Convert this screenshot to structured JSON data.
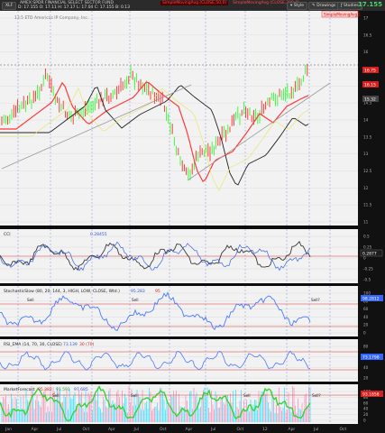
{
  "toolbar": {
    "symbol": "XLF",
    "description": "AMEX:SPDR FINANCIAL SELECT SECTOR FUND",
    "ohlc": "D: 17.155  O: 17.11  H: 17.17  L: 17.04  C: 17.155  B: 0.13",
    "study_a": "SimpleMovingAvg (CLOSE,50,0)",
    "study_b": "SimpleMovingAvg (CLOSE,200,0)",
    "style_btn": "Style",
    "drawings_btn": "Drawings",
    "studies_btn": "Studies",
    "last_price": "17.155"
  },
  "main_pane": {
    "subtitle": "13.5 ETD Americas IP Company, Inc.",
    "legend_tag": "SimpleMovingAvg 1",
    "price_labels": [
      "16.75",
      "16.15",
      "15.32"
    ],
    "axis_ticks": [
      "17",
      "16.5",
      "16",
      "15.5",
      "15",
      "14.5",
      "14",
      "13.5",
      "13",
      "12.5",
      "12",
      "11.5",
      "11"
    ]
  },
  "pane2": {
    "label": "CCI",
    "value_tag": "0.28455",
    "value": "0.2877",
    "axis_ticks": [
      "0.5",
      "0.25",
      "0",
      "-0.25",
      "-0.5"
    ]
  },
  "pane3": {
    "label": "StochasticSlow (80, 20, 144, 3, HIGH, LOW, CLOSE, Wtd.)",
    "value_tag_a": "95.283",
    "value_tag_b": "95",
    "sell_markers": [
      "Sell",
      "Sell",
      "Sell?"
    ],
    "value": "98.2812",
    "axis_ticks": [
      "100",
      "80",
      "60",
      "40",
      "20",
      "0"
    ]
  },
  "pane4": {
    "label": "RSI_EMA (14, 70, 30, CLOSE)",
    "value_tag_a": "73.139",
    "value_tag_b": "30 (70)",
    "value": "73.1798",
    "axis_ticks": [
      "80",
      "60",
      "40",
      "20"
    ]
  },
  "pane5": {
    "label": "MarketForecast",
    "value_tags": [
      "95.382",
      "91.591",
      "97.685"
    ],
    "sell_markers": [
      "Sell",
      "Sell",
      "Sell",
      "Sell?"
    ],
    "value": "93.1858",
    "axis_ticks": [
      "100",
      "80",
      "60",
      "40",
      "20",
      "0"
    ]
  },
  "time_axis": [
    "Jan",
    "Apr",
    "Jul",
    "Oct",
    "Apr",
    "Jul",
    "Oct",
    "Apr",
    "Jul",
    "Oct",
    "12",
    "Apr",
    "Jul",
    "Oct"
  ],
  "colors": {
    "price_up": "#2cff2c",
    "price_down": "#ff2a2a",
    "sma50": "#ff3a3a",
    "sma200": "#c8c8c8",
    "trendline": "#9a9a9a",
    "osc_blue": "#4a7bff",
    "mf_green": "#37d437",
    "mf_red": "#ff4a4a",
    "mf_cyan": "#5ee6ff",
    "label_red_bg": "#d62020",
    "label_green_bg": "#1f7a2f"
  },
  "icons": [
    "style-icon",
    "drawings-icon",
    "studies-icon",
    "gear-icon"
  ]
}
